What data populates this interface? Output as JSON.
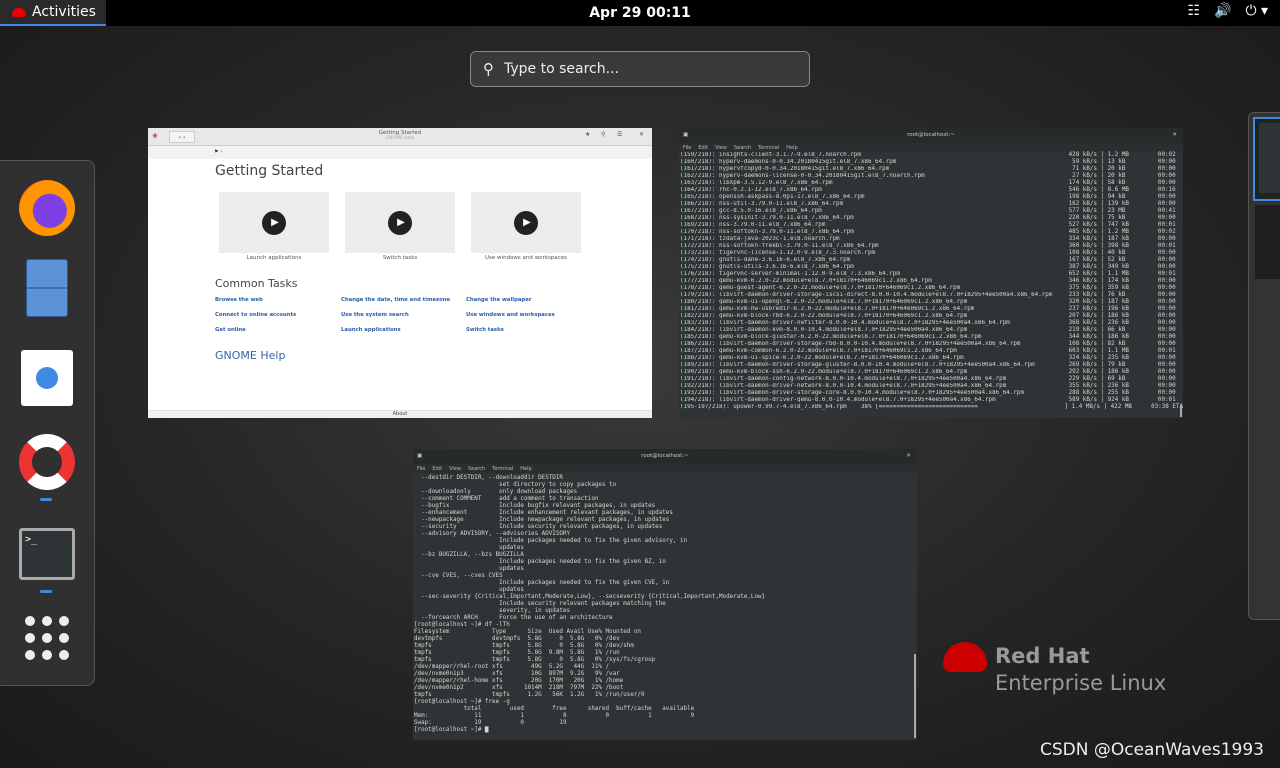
{
  "topbar": {
    "activities": "Activities",
    "clock": "Apr 29  00:11",
    "icons": [
      "network-icon",
      "volume-icon",
      "power-icon"
    ]
  },
  "search": {
    "placeholder": "Type to search..."
  },
  "dash": {
    "items": [
      {
        "name": "firefox",
        "running": false
      },
      {
        "name": "files",
        "running": false
      },
      {
        "name": "software",
        "running": false
      },
      {
        "name": "help",
        "running": true
      },
      {
        "name": "terminal",
        "running": true
      },
      {
        "name": "show-applications",
        "running": false
      }
    ]
  },
  "help_window": {
    "title": "Getting Started",
    "subtitle": "GNOME Help",
    "heading": "Getting Started",
    "videos": [
      "Launch applications",
      "Switch tasks",
      "Use windows and workspaces"
    ],
    "common_tasks": "Common Tasks",
    "links": [
      [
        "Browse the web",
        "Connect to online accounts",
        "Get online"
      ],
      [
        "Change the date, time and timezone",
        "Use the system search",
        "Launch applications"
      ],
      [
        "Change the wallpaper",
        "Use windows and workspaces",
        "Switch tasks"
      ]
    ],
    "gnome_help": "GNOME Help",
    "about": "About"
  },
  "terminal_menu": [
    "File",
    "Edit",
    "View",
    "Search",
    "Terminal",
    "Help"
  ],
  "terminal1": {
    "title": "root@localhost:~",
    "rows": [
      [
        "(159/218): insights-client-3.1.7-9.el8_7.noarch.rpm",
        "428 kB/s",
        "1.2 MB",
        "00:02"
      ],
      [
        "(160/218): hyperv-daemons-0-0.34.20180415git.el8_7.x86_64.rpm",
        "59 kB/s",
        "13 kB",
        "00:00"
      ],
      [
        "(161/218): hypervfcopyd-0-0.34.20180415git.el8_7.x86_64.rpm",
        "71 kB/s",
        "20 kB",
        "00:00"
      ],
      [
        "(162/218): hyperv-daemons-license-0-0.34.20180415git.el8_7.noarch.rpm",
        "27 kB/s",
        "20 kB",
        "00:00"
      ],
      [
        "(163/218): libXpm-3.5.12-9.el8_7.x86_64.rpm",
        "174 kB/s",
        "58 kB",
        "00:00"
      ],
      [
        "(164/218): rhc-0.2.1-12.el8_7.x86_64.rpm",
        "546 kB/s",
        "8.6 MB",
        "00:16"
      ],
      [
        "(165/218): openssh-askpass-8.0p1-17.el8_7.x86_64.rpm",
        "198 kB/s",
        "94 kB",
        "00:00"
      ],
      [
        "(166/218): nss-util-3.79.0-11.el8_7.x86_64.rpm",
        "162 kB/s",
        "139 kB",
        "00:00"
      ],
      [
        "(167/218): gcc-8.5.0-16.el8_7.x86_64.rpm",
        "577 kB/s",
        "23 MB",
        "00:41"
      ],
      [
        "(168/218): nss-sysinit-3.79.0-11.el8_7.x86_64.rpm",
        "220 kB/s",
        "75 kB",
        "00:00"
      ],
      [
        "(169/218): nss-3.79.0-11.el8_7.x86_64.rpm",
        "527 kB/s",
        "747 kB",
        "00:01"
      ],
      [
        "(170/218): nss-softokn-3.79.0-11.el8_7.x86_64.rpm",
        "485 kB/s",
        "1.2 MB",
        "00:02"
      ],
      [
        "(171/218): tzdata-java-2023c-1.el8.noarch.rpm",
        "334 kB/s",
        "187 kB",
        "00:00"
      ],
      [
        "(172/218): nss-softokn-freebl-3.79.0-11.el8_7.x86_64.rpm",
        "360 kB/s",
        "398 kB",
        "00:01"
      ],
      [
        "(173/218): tigervnc-license-1.12.0-9.el8_7.3.noarch.rpm",
        "108 kB/s",
        "40 kB",
        "00:00"
      ],
      [
        "(174/218): gnutls-dane-3.6.16-6.el8_7.x86_64.rpm",
        "167 kB/s",
        "52 kB",
        "00:00"
      ],
      [
        "(175/218): gnutls-utils-3.6.16-6.el8_7.x86_64.rpm",
        "387 kB/s",
        "349 kB",
        "00:00"
      ],
      [
        "(176/218): tigervnc-server-minimal-1.12.0-9.el8_7.3.x86_64.rpm",
        "652 kB/s",
        "1.1 MB",
        "00:01"
      ],
      [
        "(177/218): qemu-kvm-6.2.0-22.module+el8.7.0+18170+646069c1.2.x86_64.rpm",
        "346 kB/s",
        "174 kB",
        "00:00"
      ],
      [
        "(178/218): qemu-guest-agent-6.2.0-22.module+el8.7.0+18170+646069c1.2.x86_64.rpm",
        "375 kB/s",
        "359 kB",
        "00:00"
      ],
      [
        "(179/218): libvirt-daemon-driver-storage-iscsi-direct-8.0.0-10.4.module+el8.7.0+18295+4ee500a4.x86_64.rpm",
        "233 kB/s",
        "76 kB",
        "00:00"
      ],
      [
        "(180/218): qemu-kvm-ui-opengl-6.2.0-22.module+el8.7.0+18170+646069c1.2.x86_64.rpm",
        "320 kB/s",
        "187 kB",
        "00:00"
      ],
      [
        "(181/218): qemu-kvm-hw-usbredir-6.2.0-22.module+el8.7.0+18170+646069c1.2.x86_64.rpm",
        "237 kB/s",
        "196 kB",
        "00:00"
      ],
      [
        "(182/218): qemu-kvm-block-rbd-6.2.0-22.module+el8.7.0+18170+646069c1.2.x86_64.rpm",
        "207 kB/s",
        "186 kB",
        "00:00"
      ],
      [
        "(183/218): libvirt-daemon-driver-nwfilter-8.0.0-10.4.module+el8.7.0+18295+4ee500a4.x86_64.rpm",
        "368 kB/s",
        "236 kB",
        "00:00"
      ],
      [
        "(184/218): libvirt-daemon-kvm-8.0.0-10.4.module+el8.7.0+18295+4ee500a4.x86_64.rpm",
        "219 kB/s",
        "66 kB",
        "00:00"
      ],
      [
        "(185/218): qemu-kvm-block-gluster-6.2.0-22.module+el8.7.0+18170+646069c1.2.x86_64.rpm",
        "344 kB/s",
        "186 kB",
        "00:00"
      ],
      [
        "(186/218): libvirt-daemon-driver-storage-rbd-8.0.0-10.4.module+el8.7.0+18295+4ee500a4.x86_64.rpm",
        "108 kB/s",
        "82 kB",
        "00:00"
      ],
      [
        "(187/218): qemu-kvm-common-6.2.0-22.module+el8.7.0+18170+646069c1.2.x86_64.rpm",
        "603 kB/s",
        "1.1 MB",
        "00:01"
      ],
      [
        "(188/218): qemu-kvm-ui-spice-6.2.0-22.module+el8.7.0+18170+646069c1.2.x86_64.rpm",
        "324 kB/s",
        "235 kB",
        "00:00"
      ],
      [
        "(189/218): libvirt-daemon-driver-storage-gluster-8.0.0-10.4.module+el8.7.0+18295+4ee500a4.x86_64.rpm",
        "269 kB/s",
        "79 kB",
        "00:00"
      ],
      [
        "(190/218): qemu-kvm-block-ssh-6.2.0-22.module+el8.7.0+18170+646069c1.2.x86_64.rpm",
        "292 kB/s",
        "186 kB",
        "00:00"
      ],
      [
        "(191/218): libvirt-daemon-config-network-8.0.0-10.4.module+el8.7.0+18295+4ee500a4.x86_64.rpm",
        "229 kB/s",
        "69 kB",
        "00:00"
      ],
      [
        "(192/218): libvirt-daemon-driver-network-8.0.0-10.4.module+el8.7.0+18295+4ee500a4.x86_64.rpm",
        "355 kB/s",
        "236 kB",
        "00:00"
      ],
      [
        "(193/218): libvirt-daemon-driver-storage-core-8.0.0-10.4.module+el8.7.0+18295+4ee500a4.x86_64.rpm",
        "288 kB/s",
        "255 kB",
        "00:00"
      ],
      [
        "(194/218): libvirt-daemon-driver-qemu-8.0.0-10.4.module+el8.7.0+18295+4ee500a4.x86_64.rpm",
        "589 kB/s",
        "924 kB",
        "00:01"
      ]
    ],
    "progress": {
      "line": "(195-197/218): upower-0.99.7-4.el8_7.x86_64.rpm    38% [============================",
      "percent": 38,
      "rate": "] 1.4 MB/s",
      "size": "422 MB",
      "eta": "03:38 ETA"
    }
  },
  "terminal2": {
    "title": "root@localhost:~",
    "lines": [
      "  --destdir DESTDIR, --downloaddir DESTDIR",
      "                        set directory to copy packages to",
      "  --downloadonly        only download packages",
      "  --comment COMMENT     add a comment to transaction",
      "  --bugfix              Include bugfix relevant packages, in updates",
      "  --enhancement         Include enhancement relevant packages, in updates",
      "  --newpackage          Include newpackage relevant packages, in updates",
      "  --security            Include security relevant packages, in updates",
      "  --advisory ADVISORY, --advisories ADVISORY",
      "                        Include packages needed to fix the given advisory, in",
      "                        updates",
      "  --bz BUGZILLA, --bzs BUGZILLA",
      "                        Include packages needed to fix the given BZ, in",
      "                        updates",
      "  --cve CVES, --cves CVES",
      "                        Include packages needed to fix the given CVE, in",
      "                        updates",
      "  --sec-severity {Critical,Important,Moderate,Low}, --secseverity {Critical,Important,Moderate,Low}",
      "                        Include security relevant packages matching the",
      "                        severity, in updates",
      "  --forcearch ARCH      Force the use of an architecture",
      "[root@localhost ~]# df -lTh",
      "Filesystem            Type      Size  Used Avail Use% Mounted on",
      "devtmpfs              devtmpfs  5.8G     0  5.8G   0% /dev",
      "tmpfs                 tmpfs     5.8G     0  5.8G   0% /dev/shm",
      "tmpfs                 tmpfs     5.8G  9.8M  5.8G   1% /run",
      "tmpfs                 tmpfs     5.8G     0  5.8G   0% /sys/fs/cgroup",
      "/dev/mapper/rhel-root xfs        49G  5.2G   44G  11% /",
      "/dev/nvme0n1p3        xfs        10G  897M  9.2G   9% /var",
      "/dev/mapper/rhel-home xfs        20G  170M   20G   1% /home",
      "/dev/nvme0n1p2        xfs      1014M  218M  797M  22% /boot",
      "tmpfs                 tmpfs     1.2G   56K  1.2G   1% /run/user/0",
      "[root@localhost ~]# free -g",
      "              total        used        free      shared  buff/cache   available",
      "Mem:             11           1           8           0           1           9",
      "Swap:            19           0          19",
      "[root@localhost ~]# ▇"
    ]
  },
  "branding": {
    "line1": "Red Hat",
    "line2": "Enterprise Linux"
  },
  "watermark": "CSDN @OceanWaves1993",
  "colors": {
    "accent": "#3f8ae2",
    "redhat": "#ee0000",
    "link": "#2a5da8"
  }
}
